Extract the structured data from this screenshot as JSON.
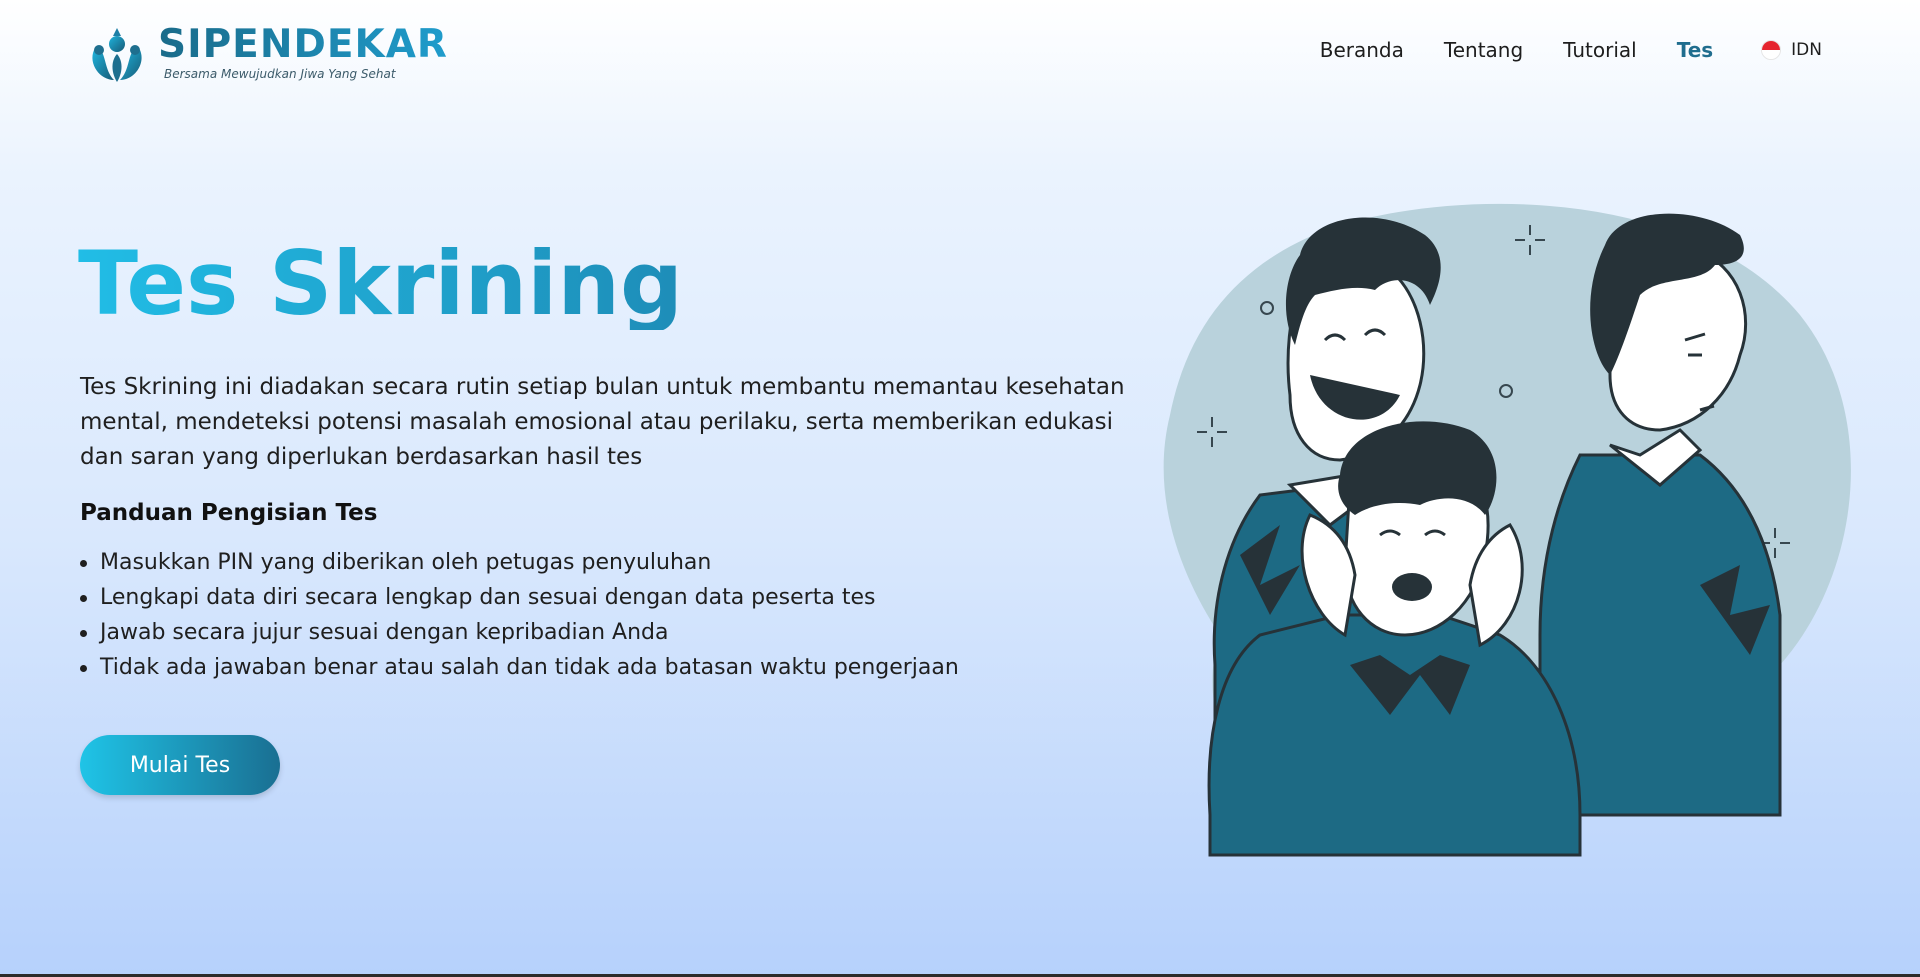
{
  "brand": {
    "name": "SIPENDEKAR",
    "tagline": "Bersama Mewujudkan Jiwa Yang Sehat"
  },
  "nav": {
    "items": [
      {
        "label": "Beranda",
        "active": false
      },
      {
        "label": "Tentang",
        "active": false
      },
      {
        "label": "Tutorial",
        "active": false
      },
      {
        "label": "Tes",
        "active": true
      }
    ],
    "language": {
      "label": "IDN",
      "icon": "indonesia-flag-icon"
    }
  },
  "hero": {
    "title": "Tes Skrining",
    "description": "Tes Skrining ini diadakan secara rutin setiap bulan untuk membantu memantau kesehatan mental, mendeteksi potensi masalah emosional atau perilaku, serta memberikan edukasi dan saran yang diperlukan berdasarkan hasil tes",
    "guide_title": "Panduan Pengisian Tes",
    "guide_items": [
      "Masukkan PIN yang diberikan oleh petugas penyuluhan",
      "Lengkapi data diri secara lengkap dan sesuai dengan data peserta tes",
      "Jawab secara jujur sesuai dengan kepribadian Anda",
      "Tidak ada jawaban benar atau salah dan tidak ada batasan waktu pengerjaan"
    ],
    "cta_label": "Mulai Tes"
  },
  "colors": {
    "accent": "#1f6d8e",
    "title_gradient_start": "#21bde6",
    "title_gradient_end": "#1e8db8",
    "button_gradient_start": "#1fc4e7",
    "button_gradient_end": "#1a6f92",
    "illustration_sweater": "#1d6a84",
    "illustration_hair": "#263238",
    "illustration_blob": "#b9d2dc"
  }
}
